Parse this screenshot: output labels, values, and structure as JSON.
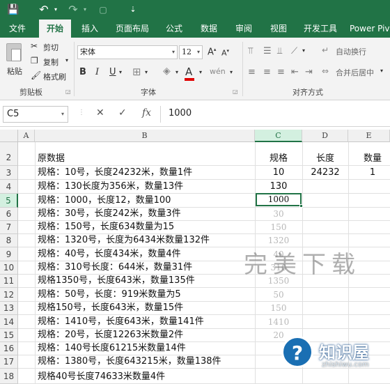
{
  "quick_access": {
    "save_icon": "💾",
    "undo_icon": "↶",
    "redo_icon": "↷",
    "customize_icon": "⇣"
  },
  "tabs": [
    "文件",
    "开始",
    "插入",
    "页面布局",
    "公式",
    "数据",
    "审阅",
    "视图",
    "开发工具",
    "Power Piv"
  ],
  "active_tab": "开始",
  "ribbon": {
    "clipboard": {
      "paste": "粘贴",
      "cut": "剪切",
      "copy": "复制",
      "format_painter": "格式刷",
      "group": "剪贴板"
    },
    "font": {
      "name": "宋体",
      "size": "12",
      "group": "字体",
      "bold": "B",
      "italic": "I",
      "underline": "U",
      "font_color": "A",
      "grow": "A",
      "shrink": "A"
    },
    "alignment": {
      "wrap": "自动换行",
      "merge": "合并后居中",
      "group": "对齐方式"
    }
  },
  "formula_bar": {
    "name_box": "C5",
    "cancel": "✕",
    "enter": "✓",
    "fx": "fx",
    "value": "1000"
  },
  "columns": [
    "A",
    "B",
    "C",
    "D",
    "E"
  ],
  "active_column": "C",
  "rows": [
    {
      "num": "1",
      "b": "",
      "c": "",
      "d": "",
      "e": ""
    },
    {
      "num": "2",
      "b": "原数据",
      "c": "规格",
      "d": "长度",
      "e": "数量"
    },
    {
      "num": "3",
      "b": "规格：10号，长度24232米，数量1件",
      "c": "10",
      "d": "24232",
      "e": "1"
    },
    {
      "num": "4",
      "b": "规格：130长度为356米，数量13件",
      "c": "130",
      "d": "",
      "e": ""
    },
    {
      "num": "5",
      "b": "规格：1000，长度12，数量100",
      "c": "1000",
      "d": "",
      "e": ""
    },
    {
      "num": "6",
      "b": "规格：30号，长度242米，数量3件",
      "c": "",
      "d": "",
      "e": ""
    },
    {
      "num": "7",
      "b": "规格：150号，长度634数量为15",
      "c": "",
      "d": "",
      "e": ""
    },
    {
      "num": "8",
      "b": "规格：1320号，长度为6434米数量132件",
      "c": "",
      "d": "",
      "e": ""
    },
    {
      "num": "9",
      "b": "规格：40号，长度434米，数量4件",
      "c": "",
      "d": "",
      "e": ""
    },
    {
      "num": "10",
      "b": "规格：310号长度：644米，数量31件",
      "c": "",
      "d": "",
      "e": ""
    },
    {
      "num": "11",
      "b": "规格1350号，长度643米，数量135件",
      "c": "",
      "d": "",
      "e": ""
    },
    {
      "num": "12",
      "b": "规格：50号，长度：919米数量为5",
      "c": "",
      "d": "",
      "e": ""
    },
    {
      "num": "13",
      "b": "规格150号，长度643米，数量15件",
      "c": "",
      "d": "",
      "e": ""
    },
    {
      "num": "14",
      "b": "规格：1410号，长度643米，数量141件",
      "c": "",
      "d": "",
      "e": ""
    },
    {
      "num": "15",
      "b": "规格：20号，长度12263米数量2件",
      "c": "",
      "d": "",
      "e": ""
    },
    {
      "num": "16",
      "b": "规格：140号长度61215米数量14件",
      "c": "",
      "d": "",
      "e": ""
    },
    {
      "num": "17",
      "b": "规格：1380号，长度643215米，数量138件",
      "c": "",
      "d": "",
      "e": ""
    },
    {
      "num": "18",
      "b": "规格40号长度74633米数量4件",
      "c": "",
      "d": "",
      "e": ""
    }
  ],
  "flash_fill_preview": [
    "30",
    "150",
    "1320",
    "40",
    "310",
    "1350",
    "50",
    "150",
    "1410",
    "20"
  ],
  "active_cell": "C5",
  "watermark": {
    "text": "完美下载",
    "logo_glyph": "?",
    "site_name": "知识屋",
    "site_domain": "zhishiwu.com"
  },
  "colors": {
    "excel_green": "#217346",
    "selection_bg": "#d3f0e0",
    "font_color_bar": "#e00000"
  }
}
